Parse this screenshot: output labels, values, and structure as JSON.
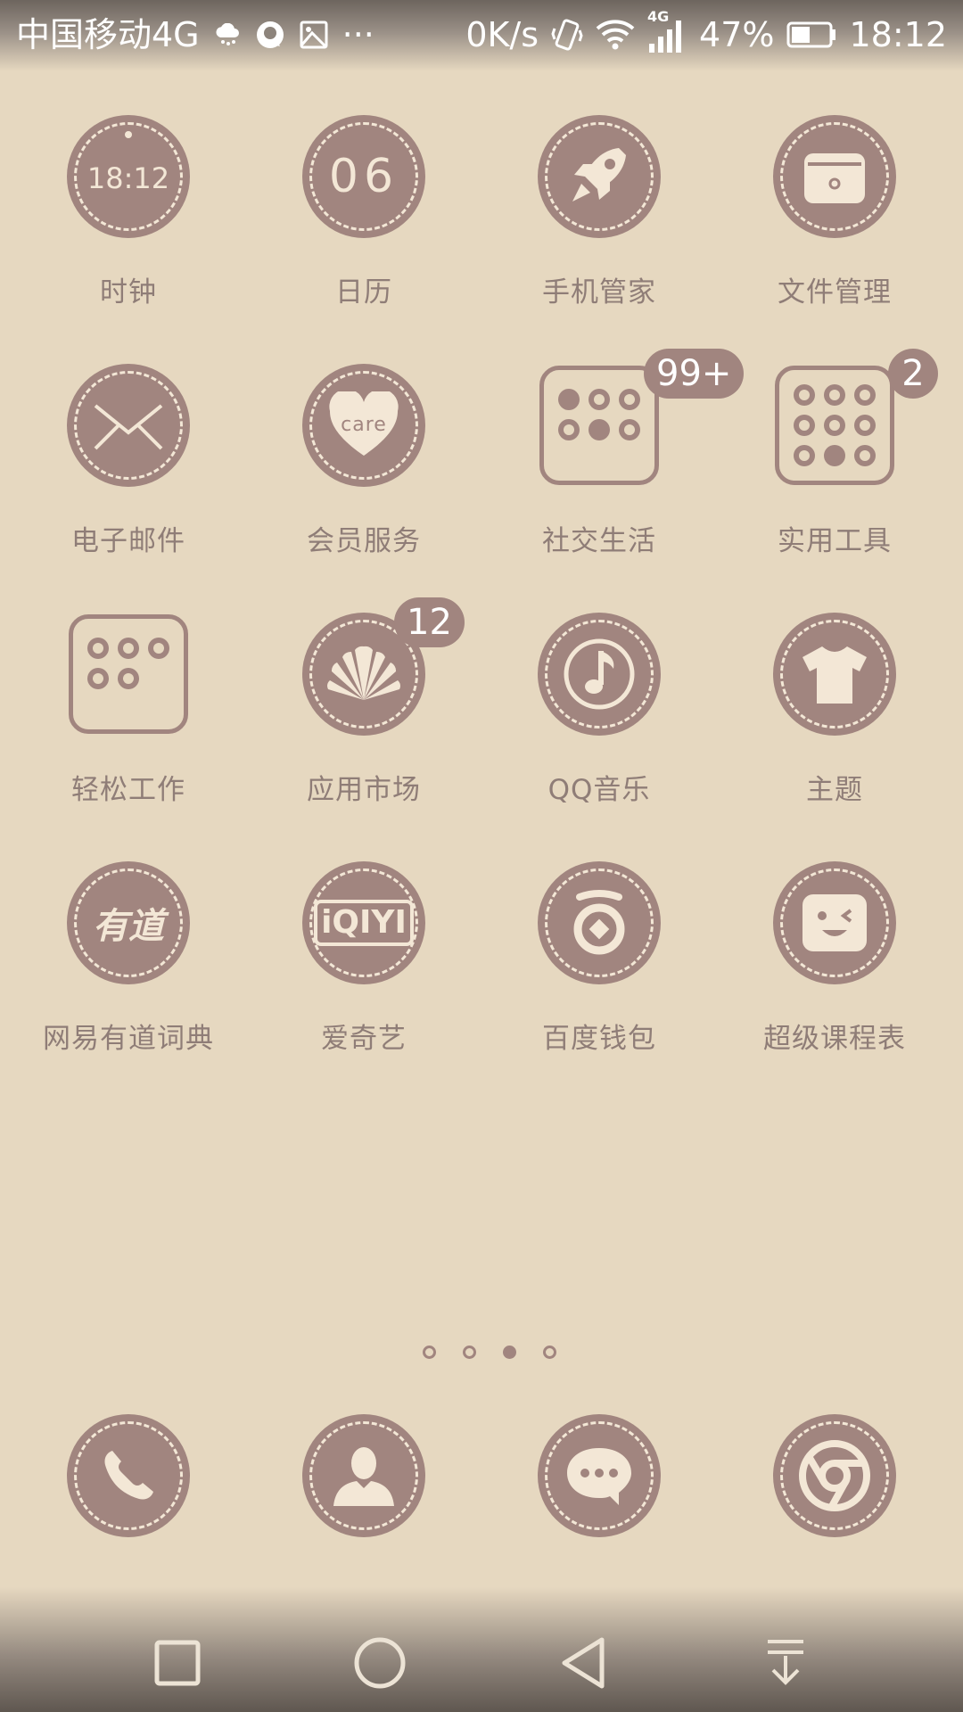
{
  "status_bar": {
    "carrier": "中国移动4G",
    "speed": "0K/s",
    "network_label": "4G",
    "battery": "47%",
    "time": "18:12",
    "overflow": "···"
  },
  "apps": [
    {
      "label": "时钟",
      "glyph": "18:12"
    },
    {
      "label": "日历",
      "glyph": "06"
    },
    {
      "label": "手机管家"
    },
    {
      "label": "文件管理"
    },
    {
      "label": "电子邮件"
    },
    {
      "label": "会员服务",
      "glyph": "care"
    },
    {
      "label": "社交生活",
      "badge": "99+"
    },
    {
      "label": "实用工具",
      "badge": "2"
    },
    {
      "label": "轻松工作"
    },
    {
      "label": "应用市场",
      "badge": "12"
    },
    {
      "label": "QQ音乐"
    },
    {
      "label": "主题"
    },
    {
      "label": "网易有道词典",
      "glyph": "有道"
    },
    {
      "label": "爱奇艺",
      "glyph": "iQIYI"
    },
    {
      "label": "百度钱包"
    },
    {
      "label": "超级课程表"
    }
  ],
  "page_indicator": {
    "count": 4,
    "active": 3
  },
  "colors": {
    "background": "#e6d8c0",
    "icon": "#a1857f",
    "icon_accent": "#f3e7d6",
    "label": "#8f7d77"
  }
}
